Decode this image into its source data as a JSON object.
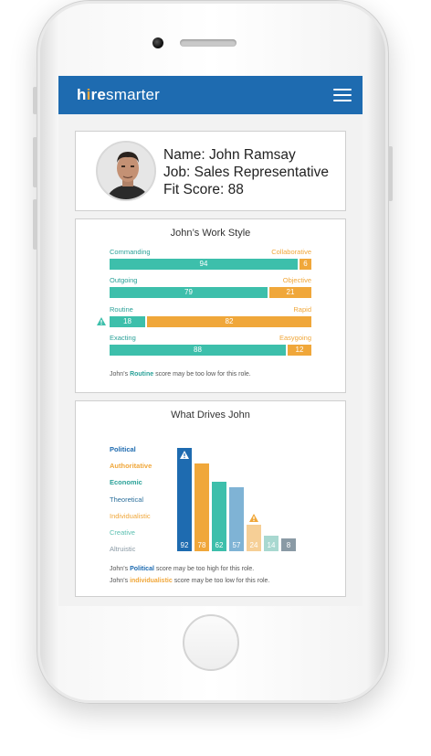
{
  "app": {
    "logo_hi": "h",
    "logo_i": "i",
    "logo_re": "re",
    "logo_rest": "smarter"
  },
  "profile": {
    "name": "Name: John Ramsay",
    "job": "Job: Sales Representative",
    "fit": "Fit Score: 88"
  },
  "work_style": {
    "title": "John’s Work Style",
    "rows": [
      {
        "left": "Commanding",
        "right": "Collaborative",
        "left_value": 94,
        "right_value": 6,
        "warning": false
      },
      {
        "left": "Outgoing",
        "right": "Objective",
        "left_value": 79,
        "right_value": 21,
        "warning": false
      },
      {
        "left": "Routine",
        "right": "Rapid",
        "left_value": 18,
        "right_value": 82,
        "warning": true
      },
      {
        "left": "Exacting",
        "right": "Easygoing",
        "left_value": 88,
        "right_value": 12,
        "warning": false
      }
    ],
    "note_prefix": "John’s ",
    "note_highlight": "Routine",
    "note_suffix": " score may be too low for this role."
  },
  "drives": {
    "title": "What Drives John",
    "items": [
      {
        "label": "Political",
        "value": 92,
        "color": "#1e6bb0",
        "label_color": "#1e6bb0",
        "bold": true,
        "warning": true
      },
      {
        "label": "Authoritative",
        "value": 78,
        "color": "#f0a73a",
        "label_color": "#f0a73a",
        "bold": true,
        "warning": false
      },
      {
        "label": "Economic",
        "value": 62,
        "color": "#3dbfab",
        "label_color": "#2aa198",
        "bold": true,
        "warning": false
      },
      {
        "label": "Theoretical",
        "value": 57,
        "color": "#7fb3d5",
        "label_color": "#2c6f9c",
        "bold": false,
        "warning": false
      },
      {
        "label": "Individualistic",
        "value": 24,
        "color": "#f6cf96",
        "label_color": "#f0a73a",
        "bold": false,
        "warning": true
      },
      {
        "label": "Creative",
        "value": 14,
        "color": "#a8d8d0",
        "label_color": "#5bbfb0",
        "bold": false,
        "warning": false
      },
      {
        "label": "Altruistic",
        "value": 8,
        "color": "#8a9aa5",
        "label_color": "#8a9aa5",
        "bold": false,
        "warning": false
      }
    ],
    "note1_prefix": "John’s ",
    "note1_highlight": "Political",
    "note1_suffix": " score may be too high for this role.",
    "note2_prefix": "John’s ",
    "note2_highlight": "individualistic",
    "note2_suffix": " score may be too low for this role."
  },
  "icons": {
    "menu": "hamburger-menu-icon",
    "warning": "warning-triangle-icon"
  }
}
